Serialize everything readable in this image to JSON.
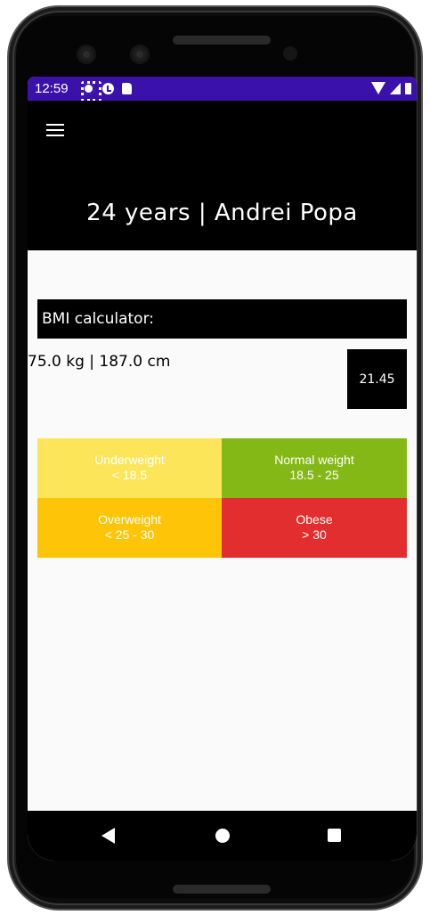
{
  "status_bar": {
    "time": "12:59",
    "background_color": "#3b11ab",
    "left_icons": [
      "settings-icon",
      "check-circle-icon",
      "sd-card-icon"
    ],
    "right_icons": [
      "wifi-icon",
      "signal-icon",
      "battery-icon"
    ]
  },
  "app_bar": {
    "menu_icon": "hamburger-menu-icon",
    "title": "24 years | Andrei Popa"
  },
  "bmi": {
    "header": "BMI calculator:",
    "measurements": "75.0 kg | 187.0 cm",
    "result": "21.45",
    "categories": [
      {
        "name": "Underweight",
        "range": "< 18.5",
        "color": "#fde55a"
      },
      {
        "name": "Normal weight",
        "range": "18.5 - 25",
        "color": "#84b817"
      },
      {
        "name": "Overweight",
        "range": "< 25 - 30",
        "color": "#fec508"
      },
      {
        "name": "Obese",
        "range": "> 30",
        "color": "#e22e2e"
      }
    ]
  },
  "nav_bar": {
    "buttons": [
      "back-icon",
      "home-icon",
      "recents-icon"
    ]
  }
}
